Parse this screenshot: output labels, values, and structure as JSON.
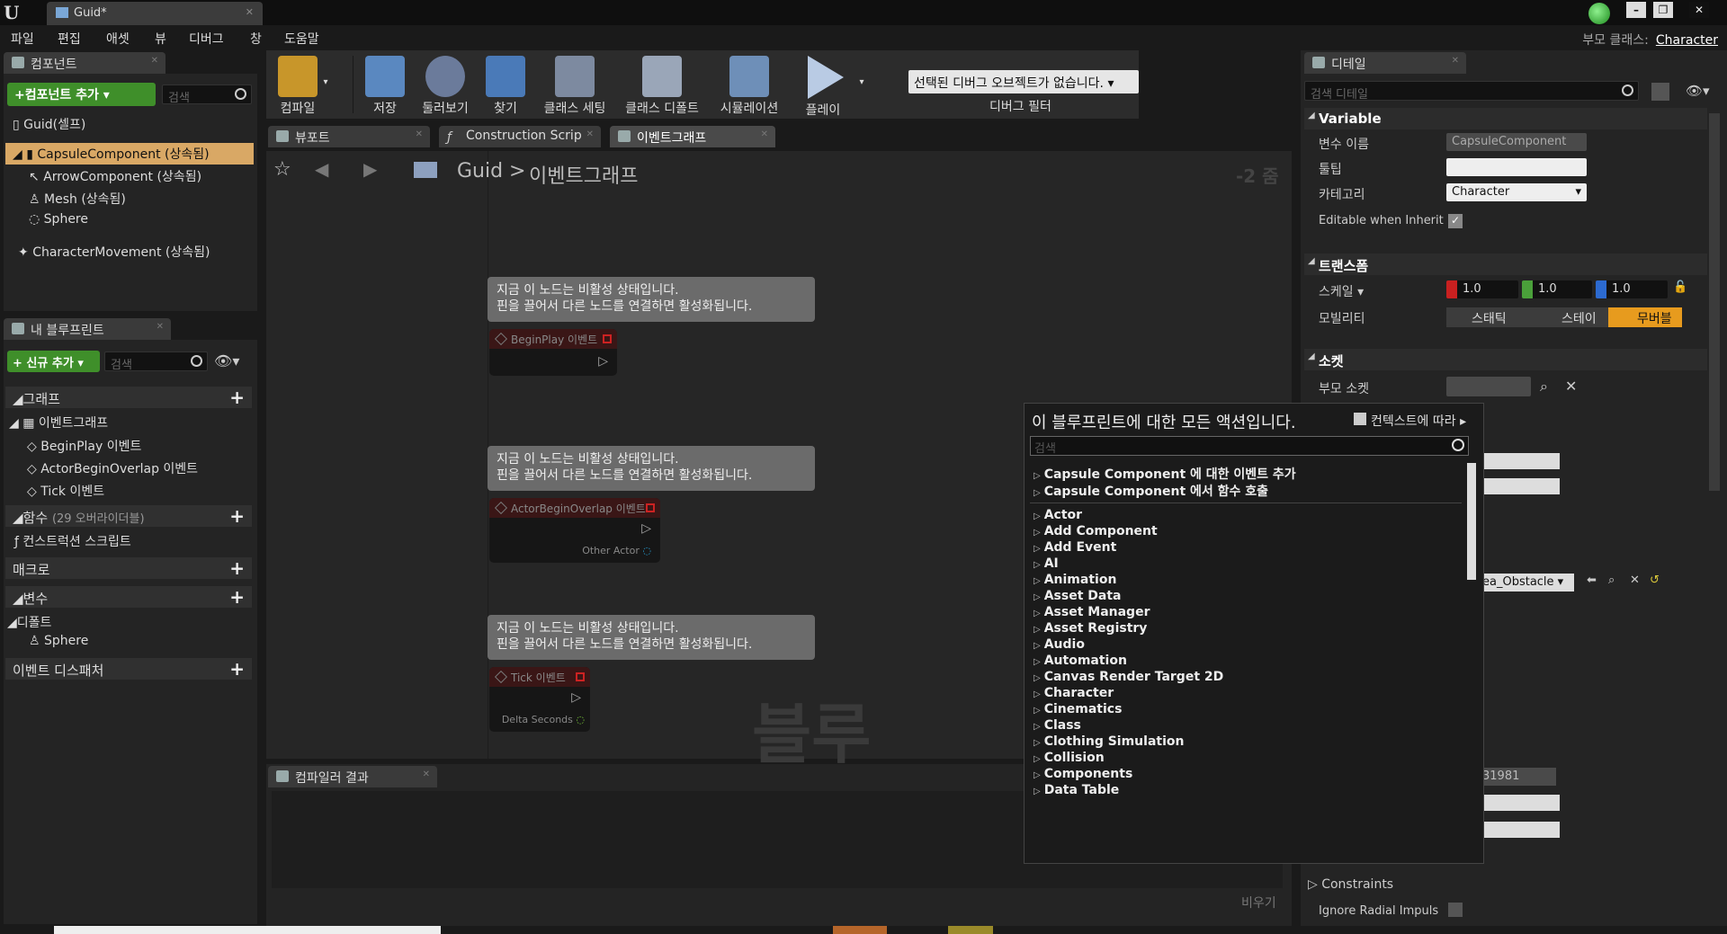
{
  "window": {
    "tab_title": "Guid*",
    "parent_class_label": "부모 클래스:",
    "parent_class_value": "Character"
  },
  "menu": [
    "파일",
    "편집",
    "애셋",
    "뷰",
    "디버그",
    "창",
    "도움말"
  ],
  "components_panel": {
    "tab": "컴포넌트",
    "add_button": "+컴포넌트 추가",
    "search_placeholder": "검색",
    "items": [
      {
        "label": "Guid(셀프)"
      },
      {
        "label": "CapsuleComponent (상속됨)"
      },
      {
        "label": "ArrowComponent (상속됨)"
      },
      {
        "label": "Mesh (상속됨)"
      },
      {
        "label": "Sphere"
      },
      {
        "label": "CharacterMovement (상속됨)"
      }
    ]
  },
  "my_blueprint": {
    "tab": "내 블루프린트",
    "add_button": "+ 신규 추가",
    "search_placeholder": "검색",
    "graph_section": "그래프",
    "eventgraph": "이벤트그래프",
    "events": [
      "BeginPlay 이벤트",
      "ActorBeginOverlap 이벤트",
      "Tick 이벤트"
    ],
    "functions_section": "함수",
    "functions_count": "(29 오버라이더블)",
    "construction_script": "컨스트럭션 스크립트",
    "macros_section": "매크로",
    "variables_section": "변수",
    "defaults_section": "디폴트",
    "defaults_item": "Sphere",
    "dispatchers_section": "이벤트 디스패처"
  },
  "toolbar": {
    "buttons": [
      "컴파일",
      "저장",
      "둘러보기",
      "찾기",
      "클래스 세팅",
      "클래스 디폴트",
      "시뮬레이션",
      "플레이"
    ],
    "debug_select": "선택된 디버그 오브젝트가 없습니다.",
    "debug_filter": "디버그 필터"
  },
  "editor_tabs": [
    "뷰포트",
    "Construction Scrip",
    "이벤트그래프"
  ],
  "breadcrumb": {
    "root": "Guid",
    "separator": ">",
    "current": "이벤트그래프",
    "zoom": "-2 줌"
  },
  "graph": {
    "comment_line1": "지금 이 노드는 비활성 상태입니다.",
    "comment_line2": "핀을 끌어서 다른 노드를 연결하면 활성화됩니다.",
    "nodes": [
      {
        "title": "BeginPlay 이벤트",
        "pin": ""
      },
      {
        "title": "ActorBeginOverlap 이벤트",
        "pin": "Other Actor"
      },
      {
        "title": "Tick 이벤트",
        "pin": "Delta Seconds"
      }
    ],
    "watermark": "블루"
  },
  "context_menu": {
    "header": "이 블루프린트에 대한 모든 액션입니다.",
    "context_label": "컨텍스트에 따라",
    "search_placeholder": "검색",
    "top_items": [
      "Capsule Component 에 대한 이벤트 추가",
      "Capsule Component 에서 함수 호출"
    ],
    "categories": [
      "Actor",
      "Add Component",
      "Add Event",
      "AI",
      "Animation",
      "Asset Data",
      "Asset Manager",
      "Asset Registry",
      "Audio",
      "Automation",
      "Canvas Render Target 2D",
      "Character",
      "Cinematics",
      "Class",
      "Clothing Simulation",
      "Collision",
      "Components",
      "Data Table"
    ]
  },
  "compiler": {
    "tab": "컴파일러 결과",
    "clear": "비우기"
  },
  "details": {
    "tab": "디테일",
    "search_placeholder": "검색 디테일",
    "variable_section": "Variable",
    "var_name_label": "변수 이름",
    "var_name_value": "CapsuleComponent",
    "tooltip_label": "툴팁",
    "category_label": "카테고리",
    "category_value": "Character",
    "editable_label": "Editable when Inherit",
    "transform_section": "트랜스폼",
    "scale_label": "스케일",
    "scale_x": "1.0",
    "scale_y": "1.0",
    "scale_z": "1.0",
    "mobility_label": "모빌리티",
    "mobility_static": "스태틱",
    "mobility_stationary": "스테이",
    "mobility_movable": "무버블",
    "socket_section": "소켓",
    "parent_socket_label": "부모 소켓",
    "area_value": "ea_Obstacle",
    "number_value": "31981",
    "constraints_label": "Constraints",
    "radial_label": "Ignore Radial Impuls"
  }
}
